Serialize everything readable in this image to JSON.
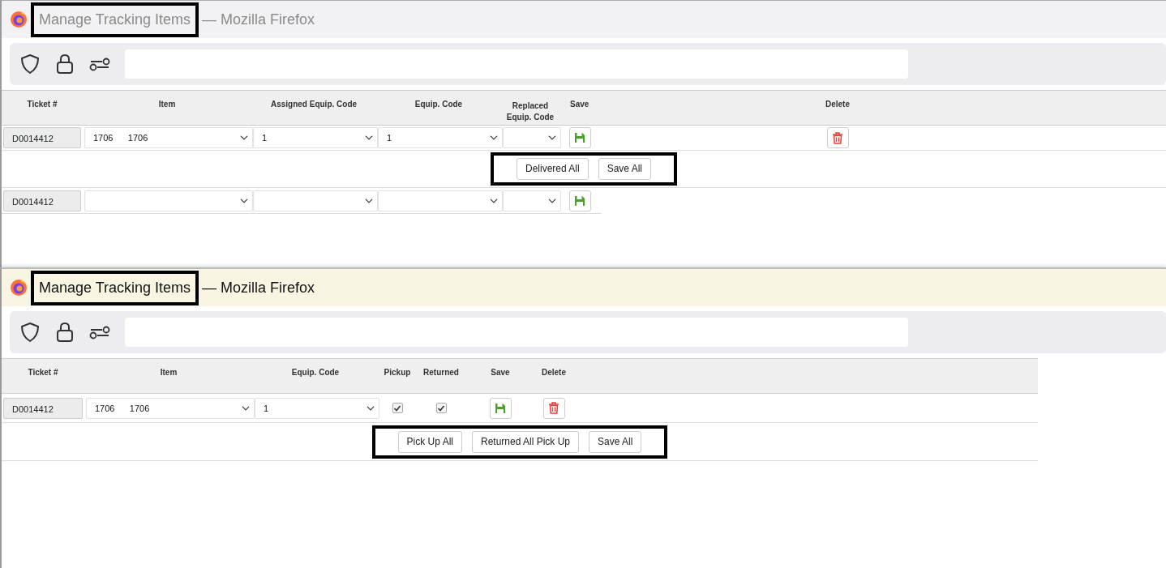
{
  "windows": [
    {
      "title": "Manage Tracking Items",
      "app": "— Mozilla Firefox",
      "active": false,
      "title_highlighted": true,
      "table": {
        "columns": [
          {
            "label": "Ticket #"
          },
          {
            "label": "Item"
          },
          {
            "label": "Assigned Equip. Code"
          },
          {
            "label": "Equip. Code"
          },
          {
            "label": "Replaced Equip. Code"
          },
          {
            "label": "Save"
          },
          {
            "label": "Delete"
          }
        ],
        "rows": [
          {
            "kind": "item",
            "cells": [
              {
                "kind": "ticket",
                "value": "D0014412"
              },
              {
                "kind": "select",
                "value": "1706      1706"
              },
              {
                "kind": "select",
                "value": "1"
              },
              {
                "kind": "select",
                "value": "1"
              },
              {
                "kind": "select"
              },
              {
                "kind": "save"
              },
              {
                "kind": "delete"
              }
            ]
          },
          {
            "kind": "actions",
            "highlighted": true,
            "buttons": [
              "Delivered All",
              "Save All"
            ]
          },
          {
            "kind": "item",
            "cells": [
              {
                "kind": "ticket",
                "value": "D0014412"
              },
              {
                "kind": "select"
              },
              {
                "kind": "select"
              },
              {
                "kind": "select"
              },
              {
                "kind": "select"
              },
              {
                "kind": "save"
              }
            ]
          }
        ]
      }
    },
    {
      "title": "Manage Tracking Items",
      "app": "— Mozilla Firefox",
      "active": true,
      "title_highlighted": true,
      "table": {
        "columns": [
          {
            "label": "Ticket #"
          },
          {
            "label": "Item"
          },
          {
            "label": "Equip. Code"
          },
          {
            "label": "Pickup"
          },
          {
            "label": "Returned"
          },
          {
            "label": "Save"
          },
          {
            "label": "Delete"
          }
        ],
        "rows": [
          {
            "kind": "item",
            "cells": [
              {
                "kind": "ticket",
                "value": "D0014412"
              },
              {
                "kind": "select",
                "value": "1706      1706"
              },
              {
                "kind": "select",
                "value": "1"
              },
              {
                "kind": "check",
                "checked": true
              },
              {
                "kind": "check",
                "checked": true
              },
              {
                "kind": "save"
              },
              {
                "kind": "delete"
              }
            ]
          },
          {
            "kind": "actions",
            "highlighted": true,
            "buttons": [
              "Pick Up All",
              "Returned All Pick Up",
              "Save All"
            ]
          }
        ]
      }
    }
  ]
}
